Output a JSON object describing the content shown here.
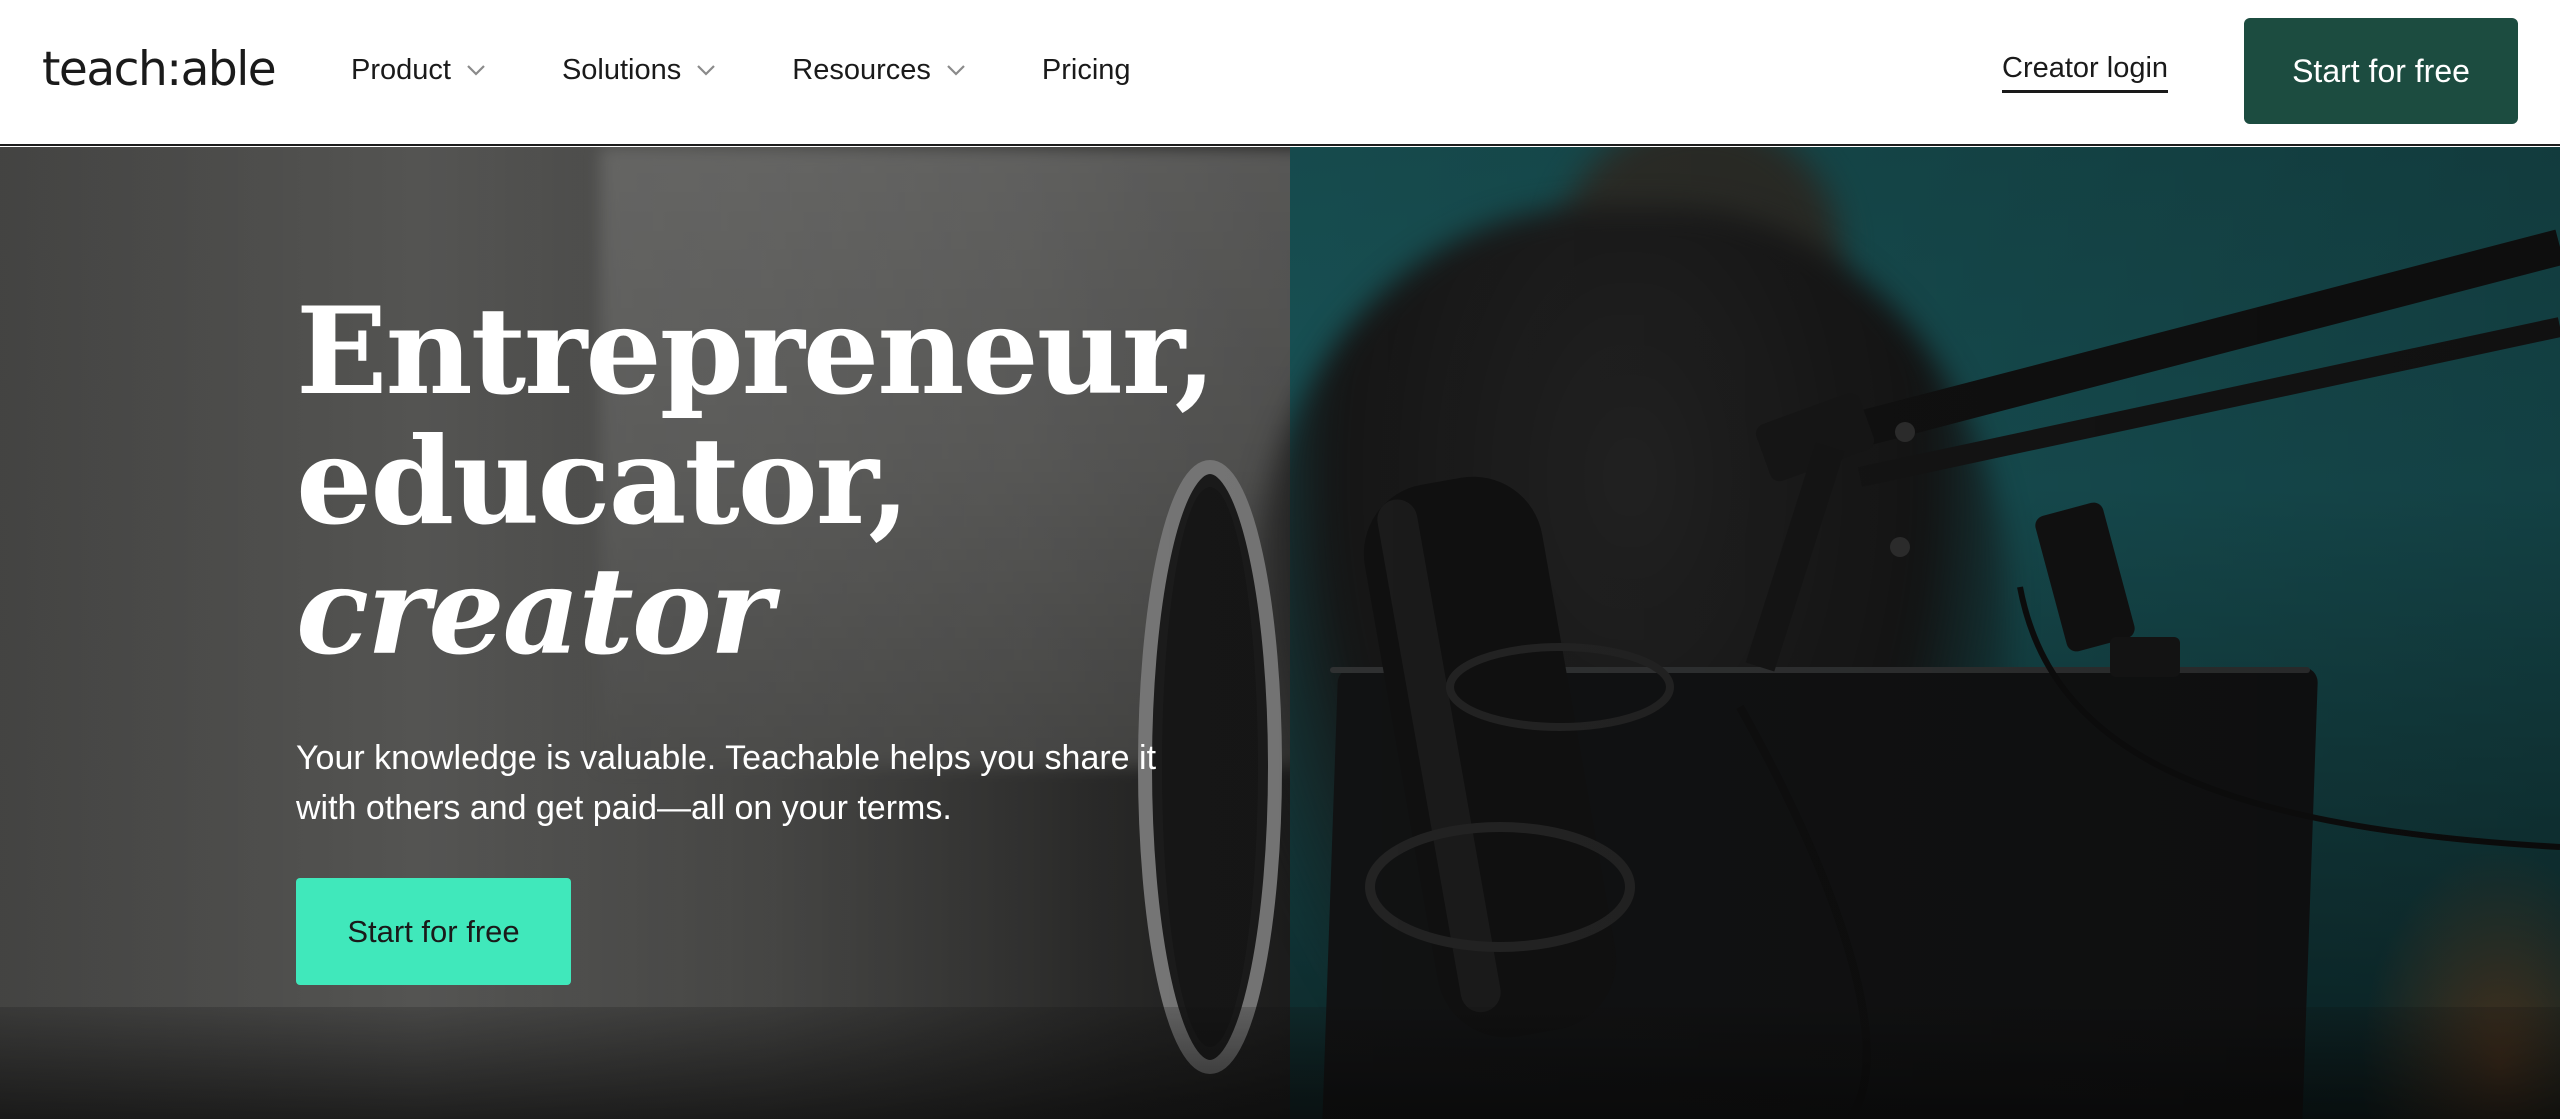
{
  "header": {
    "logo_text": "teach:able",
    "nav": [
      {
        "label": "Product",
        "has_dropdown": true,
        "icon": "chevron-down-icon"
      },
      {
        "label": "Solutions",
        "has_dropdown": true,
        "icon": "chevron-down-icon"
      },
      {
        "label": "Resources",
        "has_dropdown": true,
        "icon": "chevron-down-icon"
      },
      {
        "label": "Pricing",
        "has_dropdown": false
      }
    ],
    "login_label": "Creator login",
    "cta_label": "Start for free"
  },
  "hero": {
    "title_line1": "Entrepreneur,",
    "title_line2": "educator,",
    "title_line3": "creator",
    "subtitle": "Your knowledge is valuable. Teachable helps you share it with others and get paid—all on your terms.",
    "cta_label": "Start for free",
    "background": "photo-podcast-microphone"
  },
  "colors": {
    "header_cta_bg": "#1c4c40",
    "hero_cta_bg": "#40e8bb",
    "text_dark": "#1a1a1a",
    "text_light": "#ffffff"
  }
}
